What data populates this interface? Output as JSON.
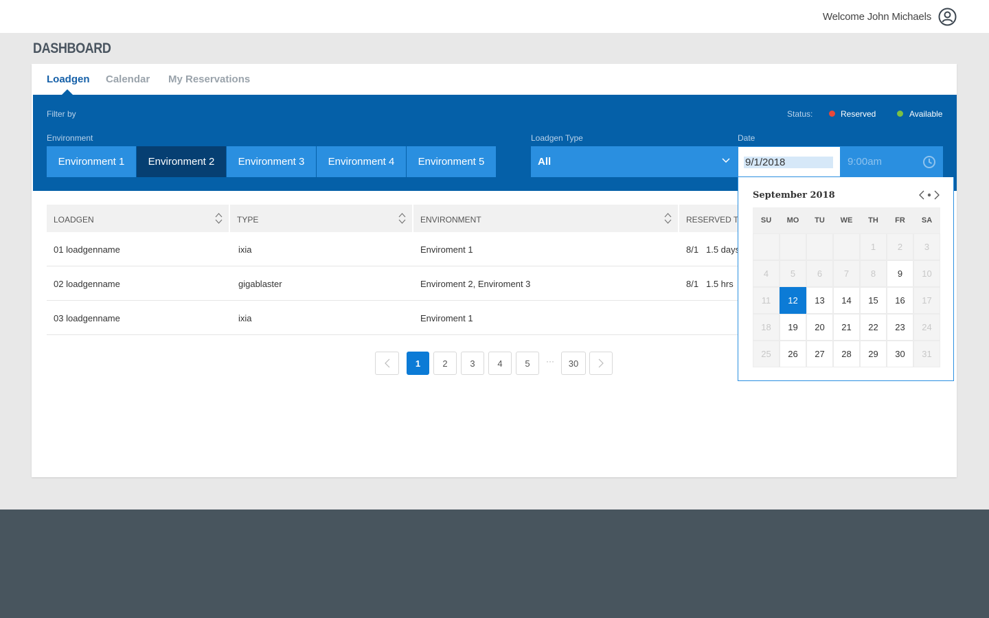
{
  "header": {
    "welcome": "Welcome John Michaels"
  },
  "page": {
    "title": "DASHBOARD"
  },
  "tabs": [
    {
      "label": "Loadgen",
      "active": true
    },
    {
      "label": "Calendar",
      "active": false
    },
    {
      "label": "My Reservations",
      "active": false
    }
  ],
  "filter": {
    "title": "Filter by",
    "status_label": "Status:",
    "status": [
      {
        "label": "Reserved",
        "color": "#e8483a"
      },
      {
        "label": "Available",
        "color": "#7bc043"
      }
    ],
    "environment_label": "Environment",
    "environments": [
      "Environment 1",
      "Environment 2",
      "Environment 3",
      "Environment 4",
      "Environment 5"
    ],
    "active_environment": "Environment 2",
    "loadgen_type_label": "Loadgen Type",
    "loadgen_type_value": "All",
    "date_label": "Date",
    "date_value": "9/1/2018",
    "time_value": "9:00am"
  },
  "table": {
    "columns": [
      "LOADGEN",
      "TYPE",
      "ENVIRONMENT",
      "RESERVED TI"
    ],
    "rows": [
      {
        "loadgen": "01 loadgenname",
        "type": "ixia",
        "environment": "Enviroment 1",
        "reserved_date": "8/1",
        "reserved_dur": "1.5 days"
      },
      {
        "loadgen": "02 loadgenname",
        "type": "gigablaster",
        "environment": "Enviroment 2, Enviroment 3",
        "reserved_date": "8/1",
        "reserved_dur": "1.5 hrs"
      },
      {
        "loadgen": "03 loadgenname",
        "type": "ixia",
        "environment": "Enviroment 1",
        "reserved_date": "",
        "reserved_dur": ""
      }
    ]
  },
  "pagination": {
    "pages": [
      "1",
      "2",
      "3",
      "4",
      "5"
    ],
    "ellipsis": "···",
    "last": "30",
    "current": "1"
  },
  "calendar": {
    "title": "September 2018",
    "weekdays": [
      "SU",
      "MO",
      "TU",
      "WE",
      "TH",
      "FR",
      "SA"
    ],
    "weeks": [
      [
        "",
        "",
        "",
        "",
        "1",
        "2",
        "3"
      ],
      [
        "4",
        "5",
        "6",
        "7",
        "8",
        "9",
        "10"
      ],
      [
        "11",
        "12",
        "13",
        "14",
        "15",
        "16",
        "17"
      ],
      [
        "18",
        "19",
        "20",
        "21",
        "22",
        "23",
        "24"
      ],
      [
        "25",
        "26",
        "27",
        "28",
        "29",
        "30",
        "31"
      ]
    ],
    "available_days": [
      "9",
      "12",
      "13",
      "14",
      "15",
      "16",
      "19",
      "20",
      "21",
      "22",
      "23",
      "26",
      "27",
      "28",
      "29",
      "30"
    ],
    "selected_day": "12"
  },
  "colors": {
    "primary": "#0560a8",
    "accent": "#2a8fe0",
    "active_env": "#063f72",
    "selected": "#0c7bd6",
    "footer": "#48555e"
  }
}
